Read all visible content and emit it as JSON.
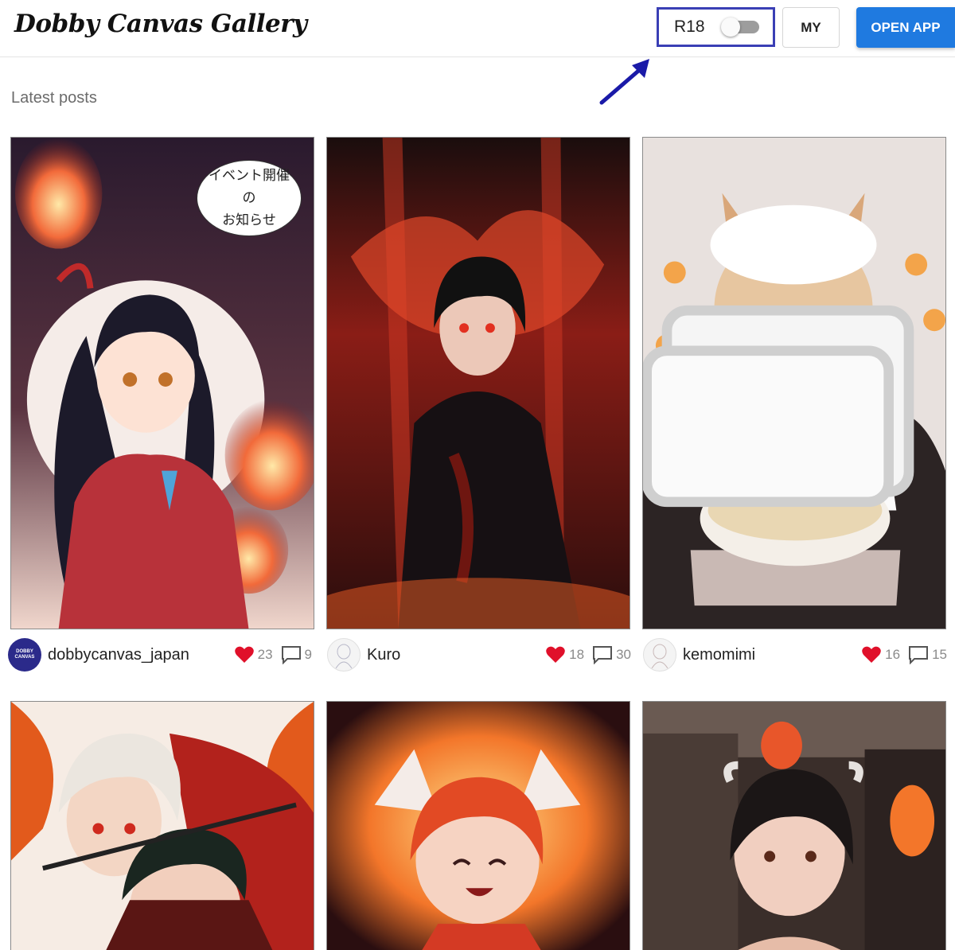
{
  "header": {
    "logo": "Dobby Canvas Gallery",
    "r18_label": "R18",
    "r18_enabled": false,
    "my_label": "MY",
    "open_app_label": "OPEN APP"
  },
  "section_title": "Latest posts",
  "posts": [
    {
      "username": "dobbycanvas_japan",
      "avatar_text": "DOBBY CANVAS",
      "likes": "23",
      "comments": "9",
      "image": "anime-girl-red-robe-fire-spirits",
      "overlay_lines": [
        "イベント開催",
        "の",
        "お知らせ"
      ]
    },
    {
      "username": "Kuro",
      "likes": "18",
      "comments": "30",
      "image": "dark-haired-boy-red-flames"
    },
    {
      "username": "kemomimi",
      "likes": "16",
      "comments": "15",
      "image": "fox-eared-girl-rice-bowl",
      "icon": "folder-icon"
    },
    {
      "image": "white-haired-warrior-flames"
    },
    {
      "image": "fox-girl-fire-tails"
    },
    {
      "image": "horned-girl-stone-castle"
    }
  ],
  "colors": {
    "accent": "#1f7ae0",
    "highlight_box": "#3a3fb5",
    "arrow": "#1a1aa8",
    "heart": "#e0102a"
  },
  "icons": [
    "heart-icon",
    "comment-icon",
    "arrow-annotation-icon",
    "folder-icon"
  ]
}
